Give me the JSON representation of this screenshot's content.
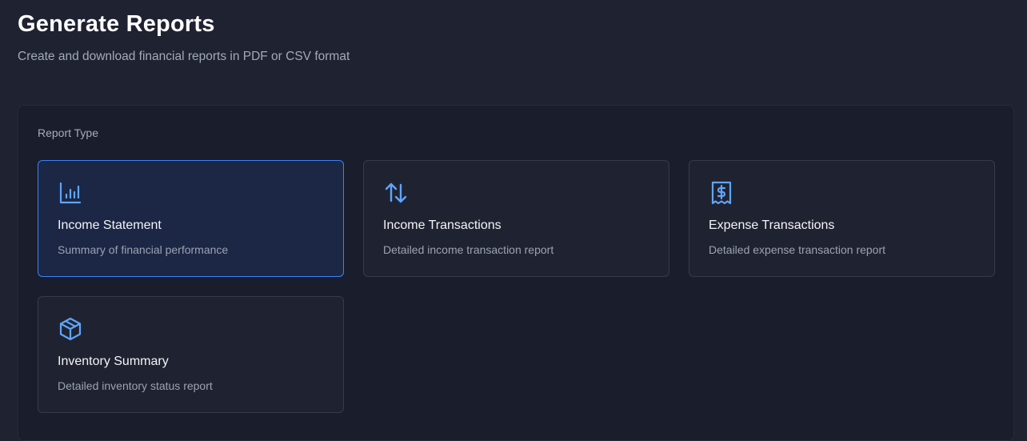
{
  "header": {
    "title": "Generate Reports",
    "subtitle": "Create and download financial reports in PDF or CSV format"
  },
  "report_type": {
    "label": "Report Type",
    "selected": "Income Statement",
    "options": [
      {
        "title": "Income Statement",
        "description": "Summary of financial performance",
        "icon": "bar-chart-icon"
      },
      {
        "title": "Income Transactions",
        "description": "Detailed income transaction report",
        "icon": "arrows-up-down-icon"
      },
      {
        "title": "Expense Transactions",
        "description": "Detailed expense transaction report",
        "icon": "receipt-dollar-icon"
      },
      {
        "title": "Inventory Summary",
        "description": "Detailed inventory status report",
        "icon": "package-cube-icon"
      }
    ]
  },
  "colors": {
    "accent": "#3b82f6",
    "icon": "#60a5fa",
    "background": "#1e2231",
    "panel": "#191d2c",
    "card": "#1f2331",
    "card_selected": "#1b2745"
  }
}
